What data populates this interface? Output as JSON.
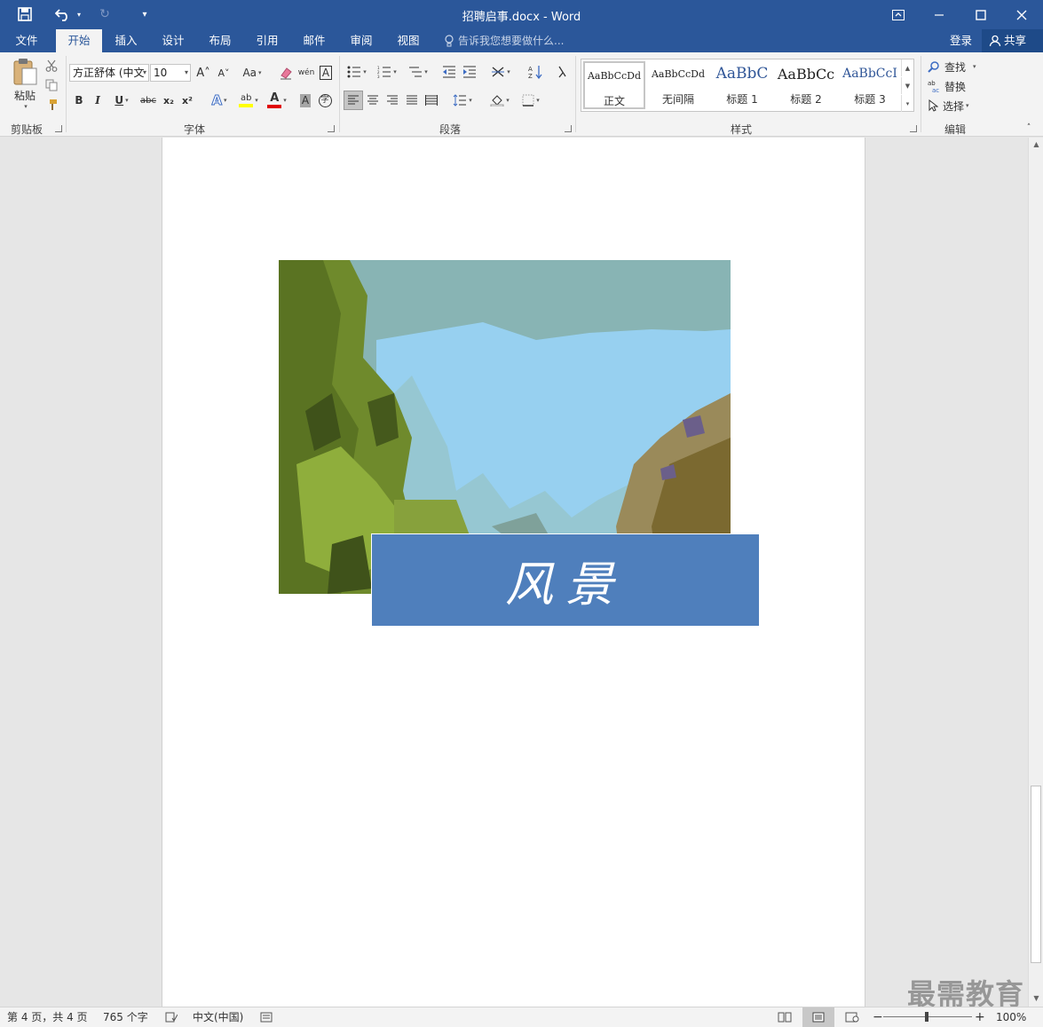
{
  "window": {
    "title": "招聘启事.docx - Word",
    "controls": {
      "ribbon_display": "⊡",
      "minimize": "—",
      "maximize": "☐",
      "close": "✕"
    }
  },
  "quick_access": {
    "save": "💾",
    "undo": "↶",
    "redo": "↻",
    "customize": "▾"
  },
  "tabs": [
    {
      "label": "文件"
    },
    {
      "label": "开始"
    },
    {
      "label": "插入"
    },
    {
      "label": "设计"
    },
    {
      "label": "布局"
    },
    {
      "label": "引用"
    },
    {
      "label": "邮件"
    },
    {
      "label": "审阅"
    },
    {
      "label": "视图"
    }
  ],
  "active_tab": "开始",
  "tell_me": {
    "placeholder": "告诉我您想要做什么..."
  },
  "account": {
    "login": "登录",
    "share": "共享"
  },
  "ribbon": {
    "clipboard": {
      "paste": "粘贴",
      "label": "剪贴板"
    },
    "font": {
      "label": "字体",
      "font_name": "方正舒体 (中文",
      "font_size": "10",
      "grow": "A˄",
      "shrink": "A˅",
      "case": "Aa",
      "bold": "B",
      "italic": "I",
      "underline": "U",
      "strike": "abc",
      "subscript": "x₂",
      "superscript": "x²",
      "text_effect": "A",
      "highlight": "ab",
      "font_color": "A",
      "char_shading": "A",
      "enclose": "字",
      "phonetic": "wén",
      "char_border": "A"
    },
    "paragraph": {
      "label": "段落"
    },
    "styles": {
      "label": "样式",
      "items": [
        {
          "preview": "AaBbCcDd",
          "name": "正文"
        },
        {
          "preview": "AaBbCcDd",
          "name": "无间隔"
        },
        {
          "preview": "AaBbC",
          "name": "标题 1"
        },
        {
          "preview": "AaBbCc",
          "name": "标题 2"
        },
        {
          "preview": "AaBbCcI",
          "name": "标题 3"
        }
      ]
    },
    "editing": {
      "label": "编辑",
      "find": "查找",
      "replace": "替换",
      "select": "选择"
    }
  },
  "document": {
    "banner_text": "风景"
  },
  "status": {
    "page": "第 4 页，共 4 页",
    "words": "765 个字",
    "language": "中文(中国)",
    "zoom": "100%",
    "zoom_minus": "−",
    "zoom_plus": "+"
  },
  "watermark": "最需教育",
  "colors": {
    "accent": "#2b579a",
    "banner": "#4f7fbc",
    "ribbon_bg": "#f3f3f3"
  }
}
